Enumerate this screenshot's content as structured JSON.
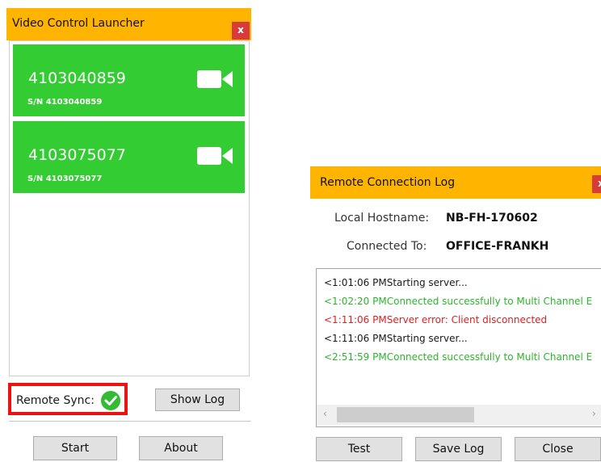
{
  "launcher": {
    "title": "Video Control Launcher",
    "close_label": "x",
    "devices": [
      {
        "name": "4103040859",
        "serial": "S/N 4103040859",
        "icon": "video-camera-icon"
      },
      {
        "name": "4103075077",
        "serial": "S/N 4103075077",
        "icon": "video-camera-icon"
      }
    ],
    "remote_sync_label": "Remote Sync:",
    "remote_sync_status_icon": "check-circle-icon",
    "show_log_label": "Show Log",
    "start_label": "Start",
    "about_label": "About"
  },
  "log_window": {
    "title": "Remote Connection Log",
    "close_label": "x",
    "local_hostname_label": "Local Hostname:",
    "local_hostname_value": "NB-FH-170602",
    "connected_to_label": "Connected To:",
    "connected_to_value": "OFFICE-FRANKH",
    "entries": [
      {
        "text": "<1:01:06 PMStarting server...",
        "status": "info"
      },
      {
        "text": "<1:02:20 PMConnected successfully to Multi Channel E",
        "status": "success"
      },
      {
        "text": "<1:11:06 PMServer error: Client disconnected",
        "status": "error"
      },
      {
        "text": "<1:11:06 PMStarting server...",
        "status": "info"
      },
      {
        "text": "<2:51:59 PMConnected successfully to Multi Channel E",
        "status": "success"
      }
    ],
    "test_label": "Test",
    "save_log_label": "Save Log",
    "close_button_label": "Close"
  },
  "colors": {
    "titlebar": "#ffb400",
    "device_tile": "#33cc33",
    "close_button": "#d93b3b",
    "highlight": "#ee1111",
    "log_info": "#1a1a1a",
    "log_success": "#2db52d",
    "log_error": "#e02020"
  }
}
